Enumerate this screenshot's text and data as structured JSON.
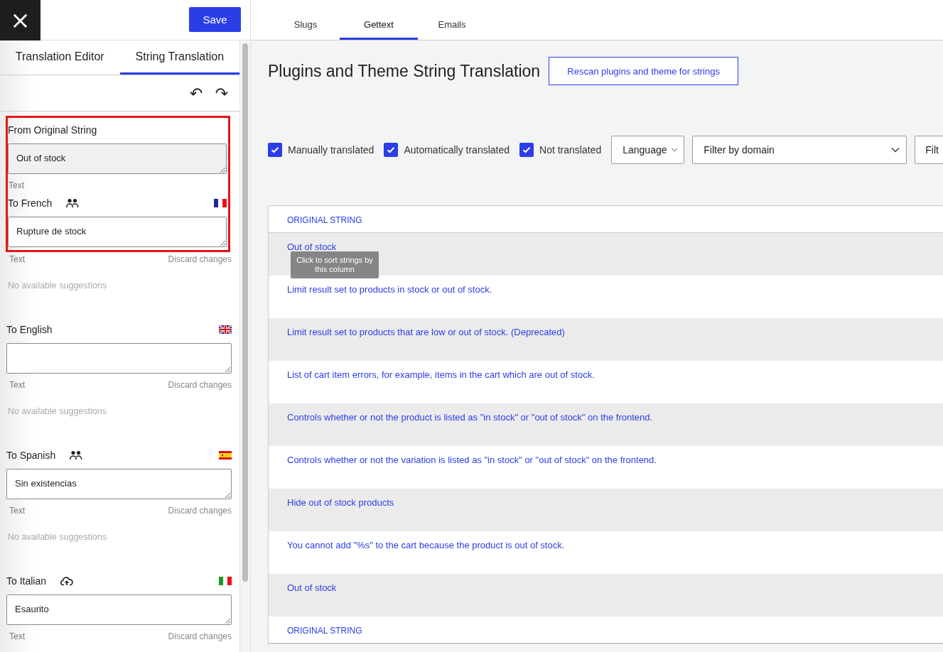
{
  "topbar": {
    "close": "×",
    "save": "Save"
  },
  "editor_tabs": [
    {
      "label": "Translation Editor",
      "selected": false
    },
    {
      "label": "String Translation",
      "selected": true
    }
  ],
  "toolbar": {
    "undo": "↶",
    "redo": "↷"
  },
  "fields": [
    {
      "kind": "original",
      "label": "From Original String",
      "value": "Out of stock",
      "hint": "Text",
      "highlighted": true
    },
    {
      "kind": "translation",
      "label": "To French",
      "translator": {
        "kind": "people"
      },
      "flag": {
        "kind": "france"
      },
      "value": "Rupture de stock",
      "hint": "Text",
      "discard": "Discard changes",
      "suggestions": "No available suggestions",
      "highlighted": true
    },
    {
      "kind": "translation",
      "label": "To English",
      "flag": {
        "kind": "uk"
      },
      "hint": "Text",
      "discard": "Discard changes",
      "suggestions": "No available suggestions",
      "highlighted": false
    },
    {
      "kind": "translation",
      "label": "To Spanish",
      "translator": {
        "kind": "people"
      },
      "flag": {
        "kind": "spain"
      },
      "value": "Sin existencias",
      "hint": "Text",
      "discard": "Discard changes",
      "suggestions": "No available suggestions",
      "highlighted": false
    },
    {
      "kind": "translation",
      "label": "To Italian",
      "translator": {
        "kind": "cloud"
      },
      "flag": {
        "kind": "italy"
      },
      "value": "Esaurito",
      "hint": "Text",
      "discard": "Discard changes",
      "highlighted": false
    }
  ],
  "tabs": [
    {
      "label": "Slugs",
      "selected": false
    },
    {
      "label": "Gettext",
      "selected": true
    },
    {
      "label": "Emails",
      "selected": false
    }
  ],
  "title": "Plugins and Theme String Translation",
  "rescan_button": "Rescan plugins and theme for strings",
  "filters": [
    {
      "label": "Manually translated",
      "checked": true
    },
    {
      "label": "Automatically translated",
      "checked": true
    },
    {
      "label": "Not translated",
      "checked": true
    }
  ],
  "selects": [
    {
      "value": "Language"
    },
    {
      "value": "Filter by domain"
    },
    {
      "value": "Filt"
    }
  ],
  "table": {
    "header": "ORIGINAL STRING",
    "rows": [
      "Out of stock",
      "Limit result set to products in stock or out of stock.",
      "Limit result set to products that are low or out of stock. (Deprecated)",
      "List of cart item errors, for example, items in the cart which are out of stock.",
      "Controls whether or not the product is listed as \"in stock\" or \"out of stock\" on the frontend.",
      "Controls whether or not the variation is listed as \"in stock\" or \"out of stock\" on the frontend.",
      "Hide out of stock products",
      "You cannot add \"%s\" to the cart because the product is out of stock.",
      "Out of stock"
    ],
    "footer_header": "ORIGINAL STRING"
  },
  "tooltip": "Click to sort strings by this column"
}
